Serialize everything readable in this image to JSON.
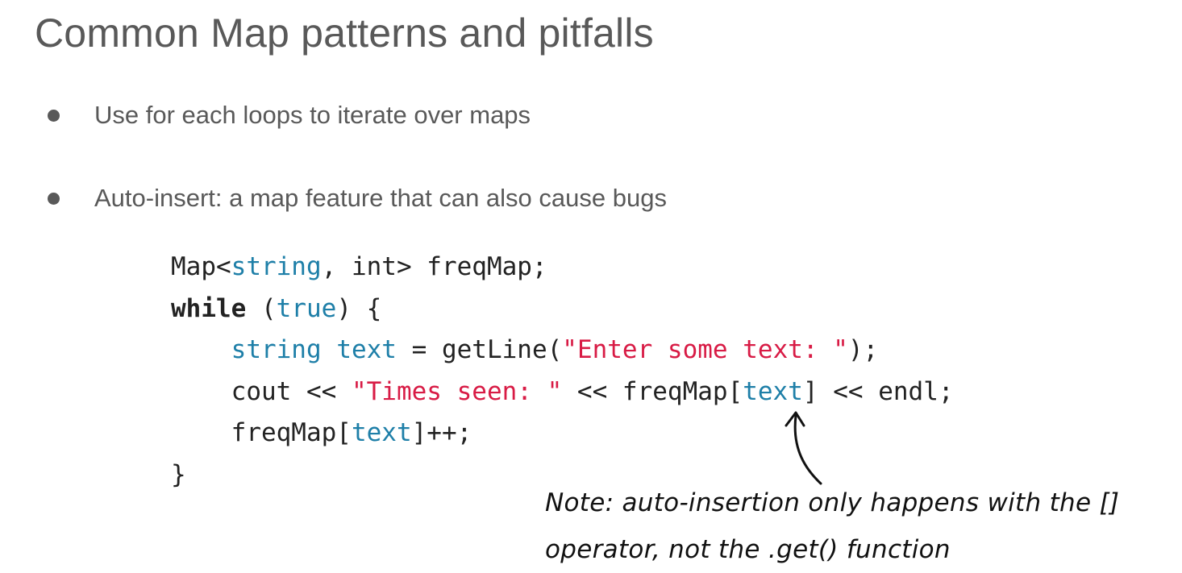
{
  "slide": {
    "title": "Common Map patterns and pitfalls",
    "bullets": [
      "Use for each loops to iterate over maps",
      "Auto-insert: a map feature that can also cause bugs"
    ]
  },
  "code": {
    "line1": {
      "a": "Map<",
      "b": "string",
      "c": ", int> freqMap;"
    },
    "line2": {
      "a": "while",
      "b": " (",
      "c": "true",
      "d": ") {"
    },
    "line3": {
      "a": "    ",
      "b": "string",
      "c": " ",
      "d": "text",
      "e": " = getLine(",
      "f": "\"Enter some text: \"",
      "g": ");"
    },
    "line4": {
      "a": "    cout << ",
      "b": "\"Times seen: \"",
      "c": " << freqMap[",
      "d": "text",
      "e": "] << endl;"
    },
    "line5": {
      "a": "    freqMap[",
      "b": "text",
      "c": "]++;"
    },
    "line6": {
      "a": "}"
    }
  },
  "note": {
    "line1": "Note: auto-insertion only happens with the []",
    "line2": "operator, not the .get() function"
  },
  "colors": {
    "text": "#595959",
    "code_type": "#1e7fa8",
    "code_string": "#d81b45",
    "code_default": "#222222"
  }
}
